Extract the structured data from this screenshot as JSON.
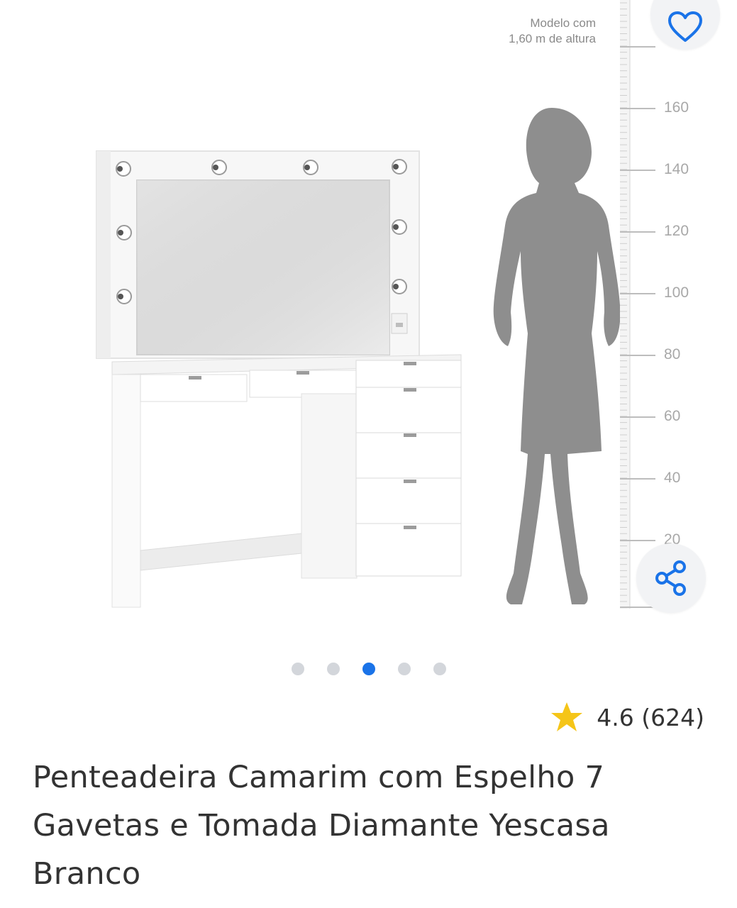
{
  "gallery": {
    "image_alt": "Penteadeira Camarim com Espelho 7 Gavetas",
    "scale_caption_line1": "Modelo com",
    "scale_caption_line2": "1,60 m de altura",
    "scale_ticks": [
      "160",
      "140",
      "120",
      "100",
      "80",
      "60",
      "40",
      "20"
    ],
    "dots": {
      "count": 5,
      "active_index": 2
    },
    "favorite_icon": "heart-outline-icon",
    "share_icon": "share-icon"
  },
  "rating": {
    "value": "4.6",
    "count": "(624)",
    "text": "4.6 (624)",
    "star_color": "#f5c518"
  },
  "product": {
    "title": "Penteadeira Camarim com Espelho 7 Gavetas e Tomada Diamante Yescasa Branco"
  },
  "colors": {
    "accent": "#1a73e8",
    "silhouette": "#8e8e8e"
  }
}
